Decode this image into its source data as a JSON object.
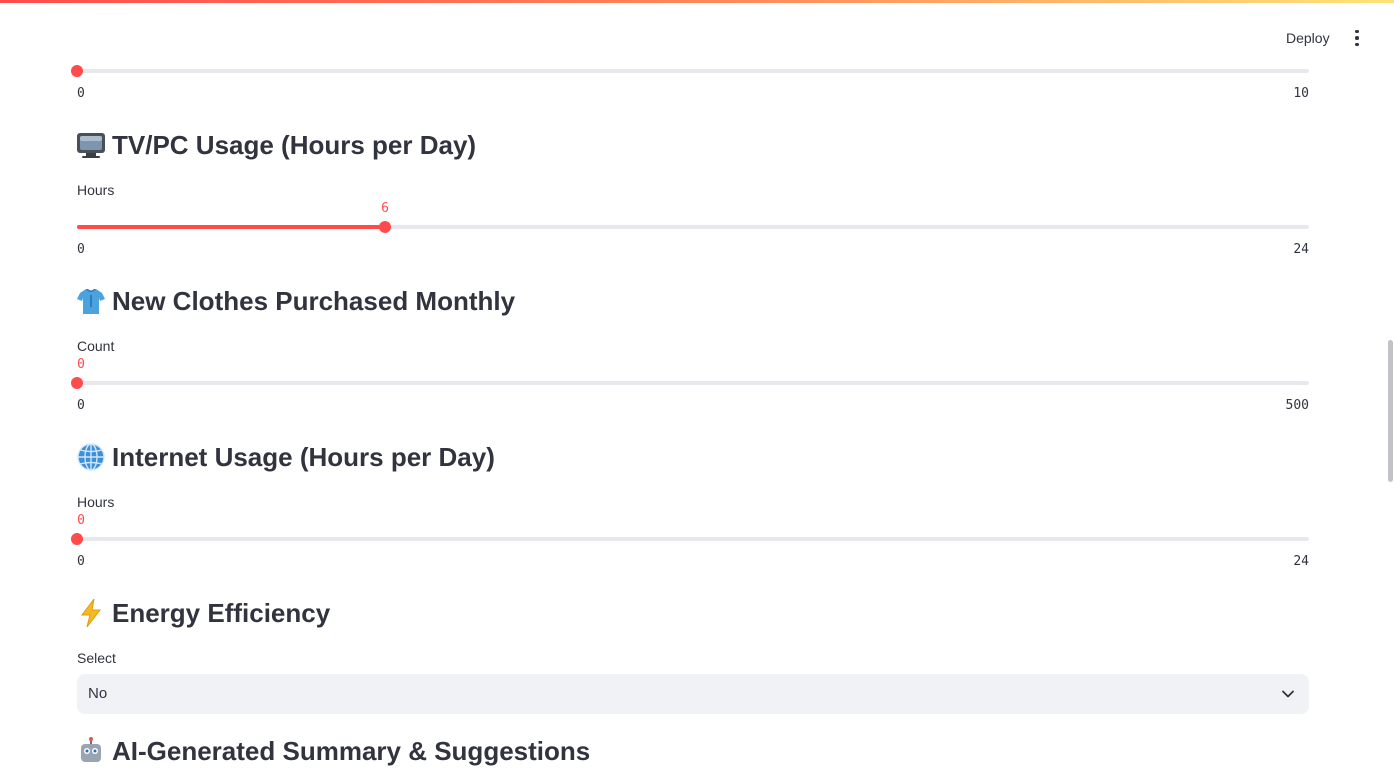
{
  "header": {
    "deploy_label": "Deploy",
    "more_icon": "vertical-ellipsis-icon"
  },
  "sections": {
    "top_slider": {
      "value": 0,
      "min_label": "0",
      "max_label": "10",
      "min": 0,
      "max": 10
    },
    "tv_pc": {
      "icon": "television-icon",
      "title": "TV/PC Usage (Hours per Day)",
      "label": "Hours",
      "value": 6,
      "value_label": "6",
      "min": 0,
      "max": 24,
      "min_label": "0",
      "max_label": "24"
    },
    "clothes": {
      "icon": "shirt-icon",
      "title": "New Clothes Purchased Monthly",
      "label": "Count",
      "value": 0,
      "value_label": "0",
      "min": 0,
      "max": 500,
      "min_label": "0",
      "max_label": "500"
    },
    "internet": {
      "icon": "globe-icon",
      "title": "Internet Usage (Hours per Day)",
      "label": "Hours",
      "value": 0,
      "value_label": "0",
      "min": 0,
      "max": 24,
      "min_label": "0",
      "max_label": "24"
    },
    "energy": {
      "icon": "lightning-icon",
      "title": "Energy Efficiency",
      "label": "Select",
      "selected": "No"
    },
    "ai_summary": {
      "icon": "robot-icon",
      "title": "AI-Generated Summary & Suggestions"
    }
  },
  "colors": {
    "accent": "#ff4b4b",
    "track": "#e6e8ee",
    "text": "#31333f",
    "select_bg": "#f0f2f6"
  }
}
